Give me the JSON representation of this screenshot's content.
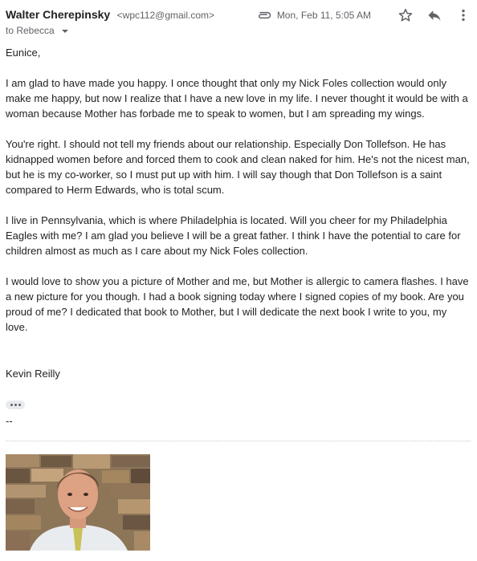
{
  "header": {
    "sender_name": "Walter Cherepinsky",
    "sender_email": "<wpc112@gmail.com>",
    "to_label": "to Rebecca",
    "date": "Mon, Feb 11, 5:05 AM",
    "icons": [
      "attachment-icon",
      "star-icon",
      "reply-icon",
      "more-vert-icon"
    ]
  },
  "body": {
    "greeting": "Eunice,",
    "paragraphs": [
      "I am glad to have made you happy. I once thought that only my Nick Foles collection would only make me happy, but now I realize that I have a new love in my life. I never thought it would be with a woman because Mother has forbade me to speak to women, but I am spreading my wings.",
      "You're right. I should not tell my friends about our relationship. Especially Don Tollefson. He has kidnapped women before and forced them to cook and clean naked for him. He's not the nicest man, but he is my co-worker, so I must put up with him. I will say though that Don Tollefson is a saint compared to Herm Edwards, who is total scum.",
      "I live in Pennsylvania, which is where Philadelphia is located. Will you cheer for my Philadelphia Eagles with me? I am glad you believe I will be a great father. I think I have the potential to care for children almost as much as I care about my Nick Foles collection.",
      "I would love to show you a picture of Mother and me, but Mother is allergic to camera flashes. I have a new picture for you though. I had a book signing today where I signed copies of my book. Are you proud of me? I dedicated that book to Mother, but I will dedicate the next book I write to you, my love."
    ],
    "signature": "Kevin Reilly",
    "sig_separator": "--"
  },
  "colors": {
    "text": "#222222",
    "meta": "#5f6368",
    "icon": "#5f6368"
  }
}
